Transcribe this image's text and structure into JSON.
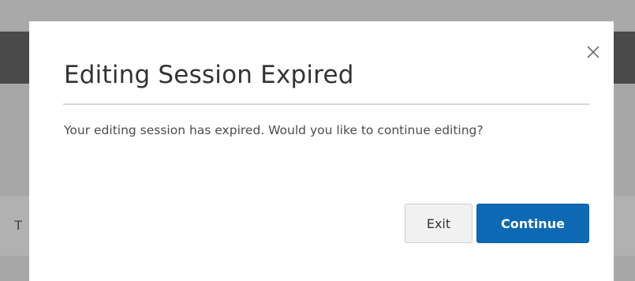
{
  "background": {
    "partial_text": "T"
  },
  "dialog": {
    "title": "Editing Session Expired",
    "message": "Your editing session has expired. Would you like to continue editing?",
    "close_label": "×",
    "exit_label": "Exit",
    "continue_label": "Continue"
  },
  "colors": {
    "primary": "#0d69b4",
    "overlay": "#a7a7a7",
    "header_band": "#4a4a4a"
  },
  "icons": {
    "close": "close-icon"
  }
}
